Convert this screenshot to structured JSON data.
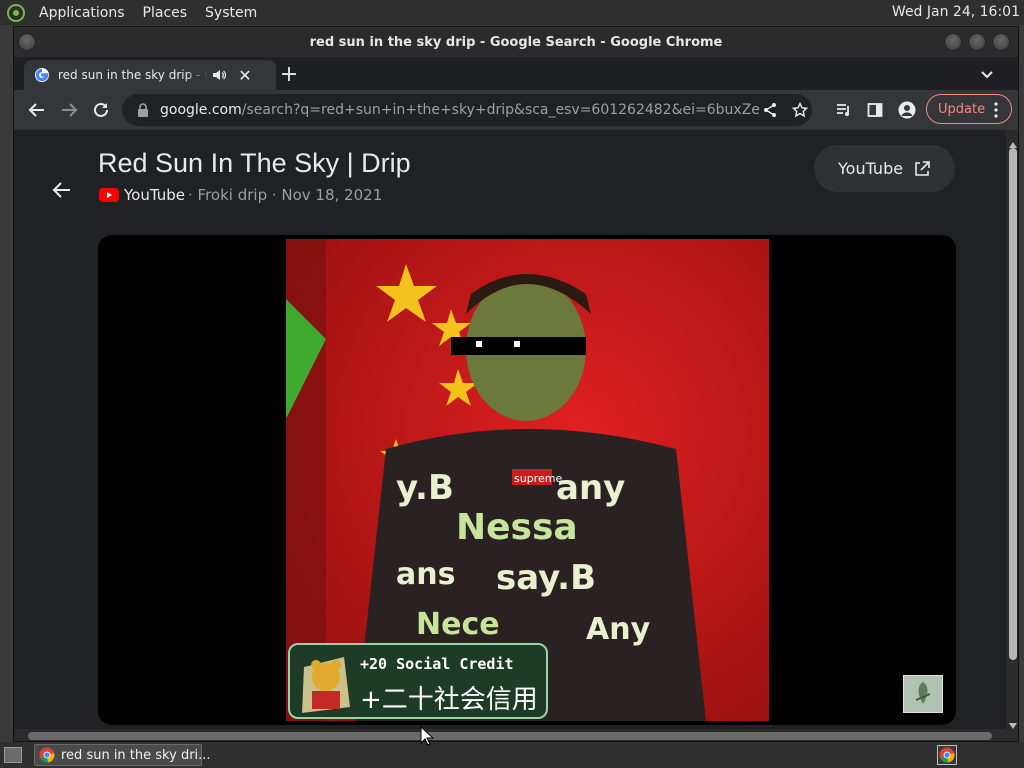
{
  "panel": {
    "menus": [
      "Applications",
      "Places",
      "System"
    ],
    "clock": "Wed Jan 24, 16:01"
  },
  "window": {
    "title": "red sun in the sky drip - Google Search - Google Chrome"
  },
  "tab": {
    "title": "red sun in the sky drip - Google Search",
    "close_icon": "close-icon",
    "audio_icon": "speaker-icon"
  },
  "toolbar": {
    "url_host": "google.com",
    "url_path": "/search?q=red+sun+in+the+sky+drip&sca_esv=601262482&ei=6buxZeapMuj97_U...",
    "update_label": "Update"
  },
  "result": {
    "title": "Red Sun In The Sky | Drip",
    "source": "YouTube",
    "meta": "· Froki drip · Nov 18, 2021",
    "open_button": "YouTube"
  },
  "video": {
    "badge_line1": "+20 Social Credit",
    "badge_line2": "+二十社会信用"
  },
  "taskbar": {
    "task_label": "red sun in the sky dri..."
  },
  "colors": {
    "accent_update": "#f28b82",
    "youtube_red": "#ff0000",
    "page_bg": "#202124"
  }
}
